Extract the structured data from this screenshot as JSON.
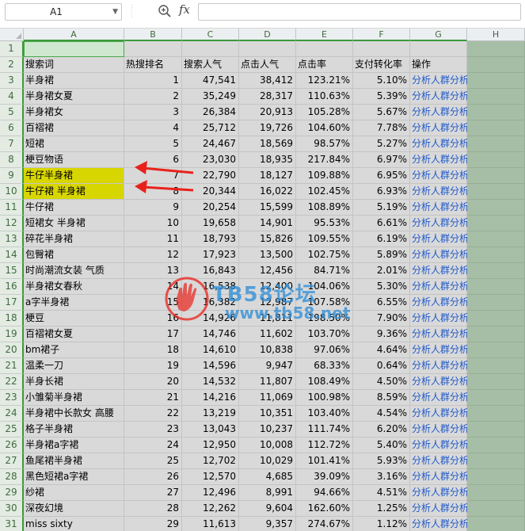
{
  "formula_bar": {
    "name_box": "A1",
    "fx_label": "fx",
    "formula": ""
  },
  "columns": [
    "A",
    "B",
    "C",
    "D",
    "E",
    "F",
    "G",
    "H"
  ],
  "header_row": {
    "keyword": "搜索词",
    "hot_rank": "热搜排名",
    "search_popularity": "搜索人气",
    "click_popularity": "点击人气",
    "click_rate": "点击率",
    "pay_conversion": "支付转化率",
    "action": "操作"
  },
  "rows": [
    {
      "n": "3",
      "kw": "半身裙",
      "rank": "1",
      "search": "47,541",
      "click": "38,412",
      "ctr": "123.21%",
      "conv": "5.10%",
      "act": "分析人群分析"
    },
    {
      "n": "4",
      "kw": "半身裙女夏",
      "rank": "2",
      "search": "35,249",
      "click": "28,317",
      "ctr": "110.63%",
      "conv": "5.39%",
      "act": "分析人群分析"
    },
    {
      "n": "5",
      "kw": "半身裙女",
      "rank": "3",
      "search": "26,384",
      "click": "20,913",
      "ctr": "105.28%",
      "conv": "5.67%",
      "act": "分析人群分析"
    },
    {
      "n": "6",
      "kw": "百褶裙",
      "rank": "4",
      "search": "25,712",
      "click": "19,726",
      "ctr": "104.60%",
      "conv": "7.78%",
      "act": "分析人群分析"
    },
    {
      "n": "7",
      "kw": "短裙",
      "rank": "5",
      "search": "24,467",
      "click": "18,569",
      "ctr": "98.57%",
      "conv": "5.27%",
      "act": "分析人群分析"
    },
    {
      "n": "8",
      "kw": "梗豆物语",
      "rank": "6",
      "search": "23,030",
      "click": "18,935",
      "ctr": "217.84%",
      "conv": "6.97%",
      "act": "分析人群分析"
    },
    {
      "n": "9",
      "kw": "牛仔半身裙",
      "rank": "7",
      "search": "22,790",
      "click": "18,127",
      "ctr": "109.88%",
      "conv": "6.95%",
      "act": "分析人群分析",
      "hl": true
    },
    {
      "n": "10",
      "kw": "牛仔裙 半身裙",
      "rank": "8",
      "search": "20,344",
      "click": "16,022",
      "ctr": "102.45%",
      "conv": "6.93%",
      "act": "分析人群分析",
      "hl": true
    },
    {
      "n": "11",
      "kw": "牛仔裙",
      "rank": "9",
      "search": "20,254",
      "click": "15,599",
      "ctr": "108.89%",
      "conv": "5.19%",
      "act": "分析人群分析"
    },
    {
      "n": "12",
      "kw": "短裙女 半身裙",
      "rank": "10",
      "search": "19,658",
      "click": "14,901",
      "ctr": "95.53%",
      "conv": "6.61%",
      "act": "分析人群分析"
    },
    {
      "n": "13",
      "kw": "碎花半身裙",
      "rank": "11",
      "search": "18,793",
      "click": "15,826",
      "ctr": "109.55%",
      "conv": "6.19%",
      "act": "分析人群分析"
    },
    {
      "n": "14",
      "kw": "包臀裙",
      "rank": "12",
      "search": "17,923",
      "click": "13,500",
      "ctr": "102.75%",
      "conv": "5.89%",
      "act": "分析人群分析"
    },
    {
      "n": "15",
      "kw": "时尚潮流女装 气质",
      "rank": "13",
      "search": "16,843",
      "click": "12,456",
      "ctr": "84.71%",
      "conv": "2.01%",
      "act": "分析人群分析"
    },
    {
      "n": "16",
      "kw": "半身裙女春秋",
      "rank": "14",
      "search": "16,538",
      "click": "12,400",
      "ctr": "104.06%",
      "conv": "5.30%",
      "act": "分析人群分析"
    },
    {
      "n": "17",
      "kw": "a字半身裙",
      "rank": "15",
      "search": "16,382",
      "click": "12,987",
      "ctr": "107.58%",
      "conv": "6.55%",
      "act": "分析人群分析"
    },
    {
      "n": "18",
      "kw": "梗豆",
      "rank": "16",
      "search": "14,926",
      "click": "11,811",
      "ctr": "198.50%",
      "conv": "7.90%",
      "act": "分析人群分析"
    },
    {
      "n": "19",
      "kw": "百褶裙女夏",
      "rank": "17",
      "search": "14,746",
      "click": "11,602",
      "ctr": "103.70%",
      "conv": "9.36%",
      "act": "分析人群分析"
    },
    {
      "n": "20",
      "kw": "bm裙子",
      "rank": "18",
      "search": "14,610",
      "click": "10,838",
      "ctr": "97.06%",
      "conv": "4.64%",
      "act": "分析人群分析"
    },
    {
      "n": "21",
      "kw": "温柔一刀",
      "rank": "19",
      "search": "14,596",
      "click": "9,947",
      "ctr": "68.33%",
      "conv": "0.64%",
      "act": "分析人群分析"
    },
    {
      "n": "22",
      "kw": "半身长裙",
      "rank": "20",
      "search": "14,532",
      "click": "11,807",
      "ctr": "108.49%",
      "conv": "4.50%",
      "act": "分析人群分析"
    },
    {
      "n": "23",
      "kw": "小雏菊半身裙",
      "rank": "21",
      "search": "14,216",
      "click": "11,069",
      "ctr": "100.98%",
      "conv": "8.59%",
      "act": "分析人群分析"
    },
    {
      "n": "24",
      "kw": "半身裙中长款女 高腰",
      "rank": "22",
      "search": "13,219",
      "click": "10,351",
      "ctr": "103.40%",
      "conv": "4.54%",
      "act": "分析人群分析"
    },
    {
      "n": "25",
      "kw": "格子半身裙",
      "rank": "23",
      "search": "13,043",
      "click": "10,237",
      "ctr": "111.74%",
      "conv": "6.20%",
      "act": "分析人群分析"
    },
    {
      "n": "26",
      "kw": "半身裙a字裙",
      "rank": "24",
      "search": "12,950",
      "click": "10,008",
      "ctr": "112.72%",
      "conv": "5.40%",
      "act": "分析人群分析"
    },
    {
      "n": "27",
      "kw": "鱼尾裙半身裙",
      "rank": "25",
      "search": "12,702",
      "click": "10,029",
      "ctr": "101.41%",
      "conv": "5.93%",
      "act": "分析人群分析"
    },
    {
      "n": "28",
      "kw": "黑色短裙a字裙",
      "rank": "26",
      "search": "12,570",
      "click": "4,685",
      "ctr": "39.09%",
      "conv": "3.16%",
      "act": "分析人群分析"
    },
    {
      "n": "29",
      "kw": "纱裙",
      "rank": "27",
      "search": "12,496",
      "click": "8,991",
      "ctr": "94.66%",
      "conv": "4.51%",
      "act": "分析人群分析"
    },
    {
      "n": "30",
      "kw": "深夜幻境",
      "rank": "28",
      "search": "12,262",
      "click": "9,604",
      "ctr": "162.60%",
      "conv": "1.25%",
      "act": "分析人群分析"
    },
    {
      "n": "31",
      "kw": "miss sixty",
      "rank": "29",
      "search": "11,613",
      "click": "9,357",
      "ctr": "274.67%",
      "conv": "1.12%",
      "act": "分析人群分析"
    }
  ],
  "watermark": {
    "title": "TB58论坛",
    "url": "www.tb58.net"
  },
  "colors": {
    "highlight": "#d8d600",
    "link": "#1f58c9",
    "selection": "#3c9a3c",
    "arrow": "#e8221b",
    "cell_bg": "#d9d9d9",
    "side_bg": "#a6bea6"
  }
}
